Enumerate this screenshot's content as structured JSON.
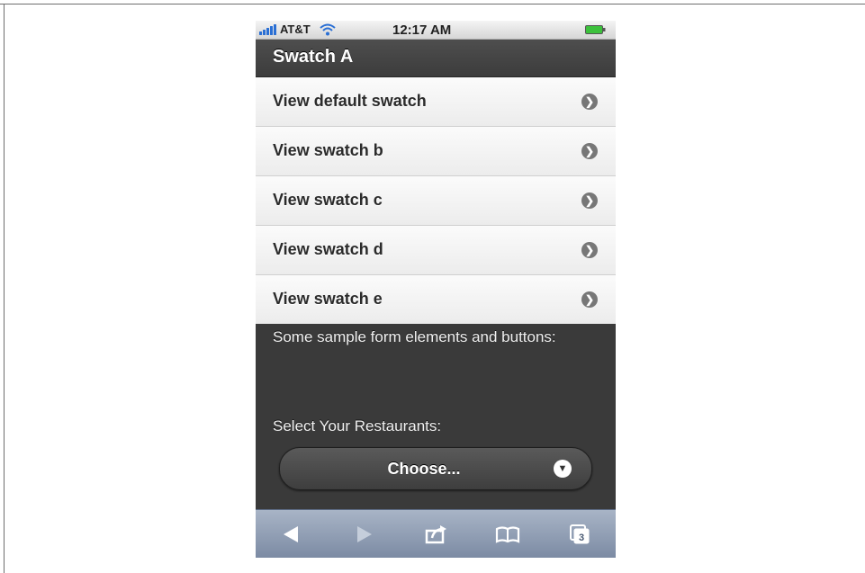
{
  "status_bar": {
    "carrier": "AT&T",
    "time": "12:17 AM"
  },
  "header": {
    "title": "Swatch A"
  },
  "list": {
    "items": [
      {
        "label": "View default swatch"
      },
      {
        "label": "View swatch b"
      },
      {
        "label": "View swatch c"
      },
      {
        "label": "View swatch d"
      },
      {
        "label": "View swatch e"
      }
    ]
  },
  "content": {
    "intro_text": "Some sample form elements and buttons:",
    "select_label": "Select Your Restaurants:",
    "select_value": "Choose..."
  },
  "toolbar": {
    "tabs_count": "3"
  },
  "colors": {
    "header_bg": "#3c3c3c",
    "body_bg": "#3a3a3a",
    "list_bg": "#f2f2f2",
    "toolbar_bg": "#8d9bb1",
    "signal": "#2a6fd4",
    "battery": "#3cc13c"
  },
  "icons": [
    "signal-icon",
    "wifi-icon",
    "battery-icon",
    "arrow-right-icon",
    "chevron-down-icon",
    "back-icon",
    "forward-icon",
    "share-icon",
    "bookmarks-icon",
    "tabs-icon"
  ]
}
